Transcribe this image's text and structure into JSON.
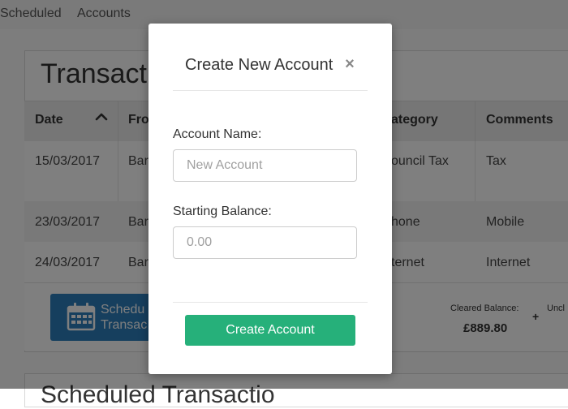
{
  "nav": {
    "scheduled_label": "Scheduled",
    "accounts_label": "Accounts"
  },
  "transactions_panel": {
    "title": "Transactio",
    "columns": [
      "Date",
      "Fro",
      "ategory",
      "Comments"
    ],
    "rows": [
      {
        "date": "15/03/2017",
        "from": "Bar",
        "category": "ouncil Tax",
        "comments": "Tax"
      },
      {
        "date": "23/03/2017",
        "from": "Bar",
        "category": "hone",
        "comments": "Mobile"
      },
      {
        "date": "24/03/2017",
        "from": "Bar",
        "category": "ternet",
        "comments": "Internet"
      }
    ],
    "schedule_button_line1": "Schedu",
    "schedule_button_line2": "Transac",
    "cleared_label": "Cleared Balance:",
    "cleared_value": "£889.80",
    "plus": "+",
    "uncleared_label": "Uncl"
  },
  "scheduled_panel": {
    "title": "Scheduled Transactio"
  },
  "modal": {
    "title": "Create New Account",
    "close_symbol": "×",
    "account_name_label": "Account Name:",
    "account_name_placeholder": "New Account",
    "account_name_value": "",
    "starting_balance_label": "Starting Balance:",
    "starting_balance_placeholder": "0.00",
    "starting_balance_value": "",
    "submit_label": "Create Account"
  },
  "colors": {
    "primary_green": "#26b07a",
    "schedule_blue": "#2d7fbd",
    "overlay": "rgba(0,0,0,0.5)"
  },
  "icons": {
    "sort": "chevron-up-icon",
    "calendar": "calendar-icon",
    "close": "close-icon"
  }
}
